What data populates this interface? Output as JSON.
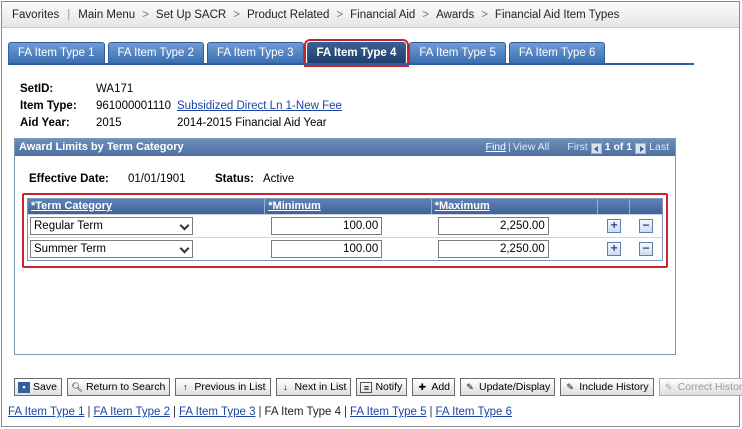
{
  "nav": {
    "items": [
      "Favorites",
      "Main Menu",
      "Set Up SACR",
      "Product Related",
      "Financial Aid",
      "Awards",
      "Financial Aid Item Types"
    ]
  },
  "tabs": [
    "FA Item Type 1",
    "FA Item Type 2",
    "FA Item Type 3",
    "FA Item Type 4",
    "FA Item Type 5",
    "FA Item Type 6"
  ],
  "active_tab": "FA Item Type 4",
  "info": {
    "setid_label": "SetID:",
    "setid_value": "WA171",
    "item_type_label": "Item Type:",
    "item_type_value": "961000001110",
    "item_type_desc": "Subsidized Direct Ln 1-New Fee",
    "aid_year_label": "Aid Year:",
    "aid_year_value": "2015",
    "aid_year_desc": "2014-2015 Financial Aid Year"
  },
  "panel": {
    "title": "Award Limits by Term Category",
    "find": "Find",
    "view_all": "View All",
    "first": "First",
    "range": "1 of 1",
    "last": "Last",
    "effective_date_label": "Effective Date:",
    "effective_date_value": "01/01/1901",
    "status_label": "Status:",
    "status_value": "Active",
    "columns": [
      "*Term Category",
      "*Minimum",
      "*Maximum"
    ],
    "rows": [
      {
        "term": "Regular Term",
        "min": "100.00",
        "max": "2,250.00"
      },
      {
        "term": "Summer Term",
        "min": "100.00",
        "max": "2,250.00"
      }
    ]
  },
  "toolbar": {
    "save": "Save",
    "return": "Return to Search",
    "prev": "Previous in List",
    "next": "Next in List",
    "notify": "Notify",
    "add": "Add",
    "update": "Update/Display",
    "include_history": "Include History",
    "correct_history": "Correct History"
  },
  "bottom_links": [
    "FA Item Type 1",
    "FA Item Type 2",
    "FA Item Type 3",
    "FA Item Type 4",
    "FA Item Type 5",
    "FA Item Type 6"
  ],
  "colors": {
    "accent": "#3b6fb2",
    "highlight": "#c8242b",
    "link": "#1b45a8"
  }
}
